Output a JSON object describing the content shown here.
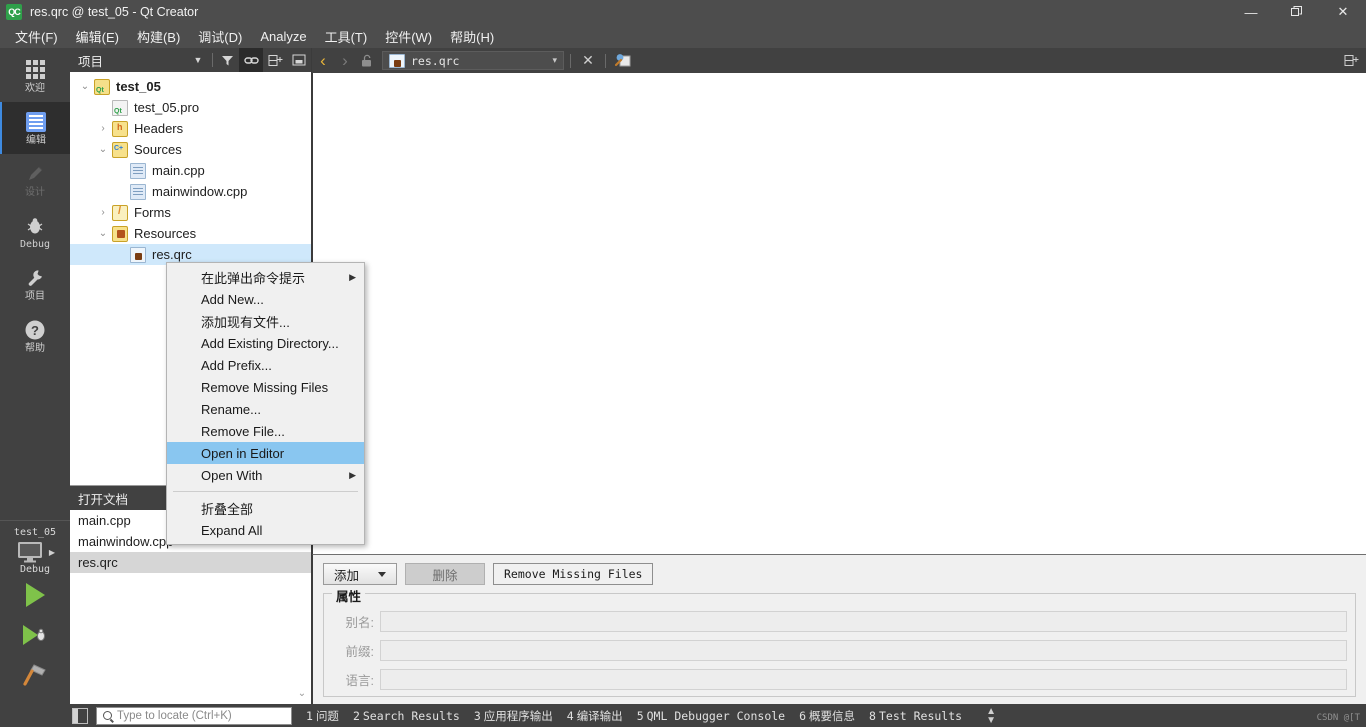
{
  "window": {
    "title": "res.qrc @ test_05 - Qt Creator",
    "logo": "QC",
    "minimize": "—",
    "maximize": "❐",
    "close": "✕"
  },
  "menubar": {
    "items": [
      {
        "label": "文件(F)",
        "name": "menu-file"
      },
      {
        "label": "编辑(E)",
        "name": "menu-edit"
      },
      {
        "label": "构建(B)",
        "name": "menu-build"
      },
      {
        "label": "调试(D)",
        "name": "menu-debug"
      },
      {
        "label": "Analyze",
        "name": "menu-analyze"
      },
      {
        "label": "工具(T)",
        "name": "menu-tools"
      },
      {
        "label": "控件(W)",
        "name": "menu-window"
      },
      {
        "label": "帮助(H)",
        "name": "menu-help"
      }
    ]
  },
  "modebar": {
    "items": [
      {
        "label": "欢迎",
        "icon": "grid-icon",
        "state": "normal"
      },
      {
        "label": "编辑",
        "icon": "document-lines-icon",
        "state": "active"
      },
      {
        "label": "设计",
        "icon": "pencil-icon",
        "state": "disabled"
      },
      {
        "label": "Debug",
        "icon": "bug-icon",
        "state": "normal"
      },
      {
        "label": "项目",
        "icon": "wrench-icon",
        "state": "normal"
      },
      {
        "label": "帮助",
        "icon": "question-circle-icon",
        "state": "normal"
      }
    ],
    "kit_name": "test_05",
    "kit_config": "Debug",
    "run_label": "run-button",
    "debug_label": "debug-button",
    "build_label": "build-button"
  },
  "project_panel": {
    "title": "项目",
    "tools": [
      {
        "name": "filter-icon",
        "glyph": "▼"
      },
      {
        "name": "link-icon",
        "glyph": "⚭",
        "active": true
      },
      {
        "name": "split-add-icon",
        "glyph": "⬚+"
      },
      {
        "name": "collapse-icon",
        "glyph": "▣"
      }
    ],
    "tree": [
      {
        "indent": 0,
        "arrow": "⌄",
        "icon": "qt-project-icon",
        "label": "test_05",
        "bold": true,
        "selected": false
      },
      {
        "indent": 1,
        "arrow": "",
        "icon": "qt-pro-file-icon",
        "label": "test_05.pro",
        "bold": false,
        "selected": false
      },
      {
        "indent": 1,
        "arrow": "›",
        "icon": "headers-folder-icon",
        "label": "Headers",
        "bold": false,
        "selected": false
      },
      {
        "indent": 1,
        "arrow": "⌄",
        "icon": "sources-folder-icon",
        "label": "Sources",
        "bold": false,
        "selected": false
      },
      {
        "indent": 2,
        "arrow": "",
        "icon": "cpp-file-icon",
        "label": "main.cpp",
        "bold": false,
        "selected": false
      },
      {
        "indent": 2,
        "arrow": "",
        "icon": "cpp-file-icon",
        "label": "mainwindow.cpp",
        "bold": false,
        "selected": false
      },
      {
        "indent": 1,
        "arrow": "›",
        "icon": "forms-folder-icon",
        "label": "Forms",
        "bold": false,
        "selected": false
      },
      {
        "indent": 1,
        "arrow": "⌄",
        "icon": "resources-folder-icon",
        "label": "Resources",
        "bold": false,
        "selected": false
      },
      {
        "indent": 2,
        "arrow": "",
        "icon": "qrc-file-icon",
        "label": "res.qrc",
        "bold": false,
        "selected": true
      }
    ]
  },
  "open_documents": {
    "title": "打开文档",
    "items": [
      {
        "label": "main.cpp",
        "selected": false
      },
      {
        "label": "mainwindow.cpp",
        "selected": false
      },
      {
        "label": "res.qrc",
        "selected": true
      }
    ]
  },
  "editor_toolbar": {
    "back": "‹",
    "forward": "›",
    "lock_icon": "unlocked-padlock-icon",
    "file_icon": "qrc-file-icon",
    "file_name": "res.qrc",
    "combo_arrow": "▾",
    "close": "✕",
    "split_icon": "split-editor-icon"
  },
  "context_menu": {
    "items": [
      {
        "label": "在此弹出命令提示",
        "submenu": true,
        "highlight": false,
        "separator_after": false
      },
      {
        "label": "Add New...",
        "submenu": false,
        "highlight": false,
        "separator_after": false
      },
      {
        "label": "添加现有文件...",
        "submenu": false,
        "highlight": false,
        "separator_after": false
      },
      {
        "label": "Add Existing Directory...",
        "submenu": false,
        "highlight": false,
        "separator_after": false
      },
      {
        "label": "Add Prefix...",
        "submenu": false,
        "highlight": false,
        "separator_after": false
      },
      {
        "label": "Remove Missing Files",
        "submenu": false,
        "highlight": false,
        "separator_after": false
      },
      {
        "label": "Rename...",
        "submenu": false,
        "highlight": false,
        "separator_after": false
      },
      {
        "label": "Remove File...",
        "submenu": false,
        "highlight": false,
        "separator_after": false
      },
      {
        "label": "Open in Editor",
        "submenu": false,
        "highlight": true,
        "separator_after": false
      },
      {
        "label": "Open With",
        "submenu": true,
        "highlight": false,
        "separator_after": true
      },
      {
        "label": "折叠全部",
        "submenu": false,
        "highlight": false,
        "separator_after": false
      },
      {
        "label": "Expand All",
        "submenu": false,
        "highlight": false,
        "separator_after": false
      }
    ],
    "submenu_arrow": "▶"
  },
  "resource_editor": {
    "add_button": "添加",
    "remove_button": "删除",
    "remove_missing_button": "Remove Missing Files",
    "group_title": "属性",
    "properties": [
      {
        "label": "别名:",
        "value": "",
        "name": "alias-field"
      },
      {
        "label": "前缀:",
        "value": "",
        "name": "prefix-field"
      },
      {
        "label": "语言:",
        "value": "",
        "name": "language-field"
      }
    ]
  },
  "statusbar": {
    "locator_placeholder": "Type to locate (Ctrl+K)",
    "tabs": [
      {
        "num": "1",
        "label": "问题"
      },
      {
        "num": "2",
        "label": "Search Results"
      },
      {
        "num": "3",
        "label": "应用程序输出"
      },
      {
        "num": "4",
        "label": "编译输出"
      },
      {
        "num": "5",
        "label": "QML Debugger Console"
      },
      {
        "num": "6",
        "label": "概要信息"
      },
      {
        "num": "8",
        "label": "Test Results"
      }
    ],
    "updown": "⬍",
    "watermark": "CSDN @[T"
  },
  "colors": {
    "chrome": "#4d4d4d",
    "panel": "#414141",
    "accent": "#3e8ae0",
    "selection": "#cfe8fb",
    "menu_highlight": "#89c6f0"
  }
}
